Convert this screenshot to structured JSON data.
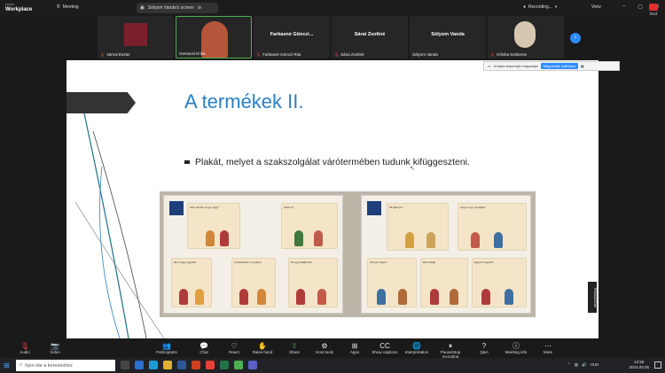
{
  "app": {
    "brand_top": "zoom",
    "brand": "Workplace",
    "meeting_label": "Meeting",
    "screen_share_label": "Sólyom Vanda's screen",
    "recording_label": "Recording...",
    "view_label": "View"
  },
  "participants": [
    {
      "name": "Varnai Eszter",
      "big": ""
    },
    {
      "name": "Gernacsi Erika",
      "big": ""
    },
    {
      "name": "Farkasné Gönczi Rita",
      "big": "Farkasné Gönczi..."
    },
    {
      "name": "Sárai Zsoltné",
      "big": "Sárai Zsoltné"
    },
    {
      "name": "Sólyom Vanda",
      "big": "Sólyom Vanda"
    },
    {
      "name": "Hőnika Szekeres",
      "big": ""
    }
  ],
  "slide": {
    "zoom_text": "A teljes képernyő megosztja",
    "zoom_btn": "Megosztás leállítása",
    "title": "A termékek II.",
    "bullet": "Plakát, melyet a szakszolgálat várótermében tudunk kifüggeszteni.",
    "side_label": "PEDAGÓGIAI",
    "panels_left": [
      "Szia, Emília, hogy vagy?",
      "Ülész itt",
      "Nem vagy egyedül",
      "A kisebbeket is segíted",
      "Én úgy találkozok..."
    ],
    "panels_right": [
      "Mindjárt jön",
      "Anya, hogy mondják?",
      "Kérnék sürgős",
      "Elmondják..",
      "Együtt megyünk"
    ]
  },
  "toolbar": [
    {
      "label": "Audio",
      "icon": "🎙",
      "style": "red"
    },
    {
      "label": "Video",
      "icon": "📷",
      "style": "red"
    },
    {
      "label": "Participants",
      "icon": "👥",
      "style": ""
    },
    {
      "label": "Chat",
      "icon": "💬",
      "style": ""
    },
    {
      "label": "React",
      "icon": "♡",
      "style": ""
    },
    {
      "label": "Raise hand",
      "icon": "✋",
      "style": ""
    },
    {
      "label": "Share",
      "icon": "⇧",
      "style": "green"
    },
    {
      "label": "Host tools",
      "icon": "⚙",
      "style": ""
    },
    {
      "label": "Apps",
      "icon": "⊞",
      "style": ""
    },
    {
      "label": "Show captions",
      "icon": "CC",
      "style": ""
    },
    {
      "label": "Interpretation",
      "icon": "🌐",
      "style": ""
    },
    {
      "label": "Pause/stop recording",
      "icon": "⏸",
      "style": ""
    },
    {
      "label": "Q&A",
      "icon": "?",
      "style": ""
    },
    {
      "label": "Meeting info",
      "icon": "ⓘ",
      "style": ""
    },
    {
      "label": "More",
      "icon": "⋯",
      "style": ""
    }
  ],
  "end_label": "End",
  "taskbar": {
    "search_placeholder": "Írjon ide a kereséshez",
    "lang": "HUN",
    "time": "12:56",
    "date": "2023.09.05"
  },
  "colors": {
    "accent": "#2d8cff",
    "title": "#2a7fc4"
  }
}
